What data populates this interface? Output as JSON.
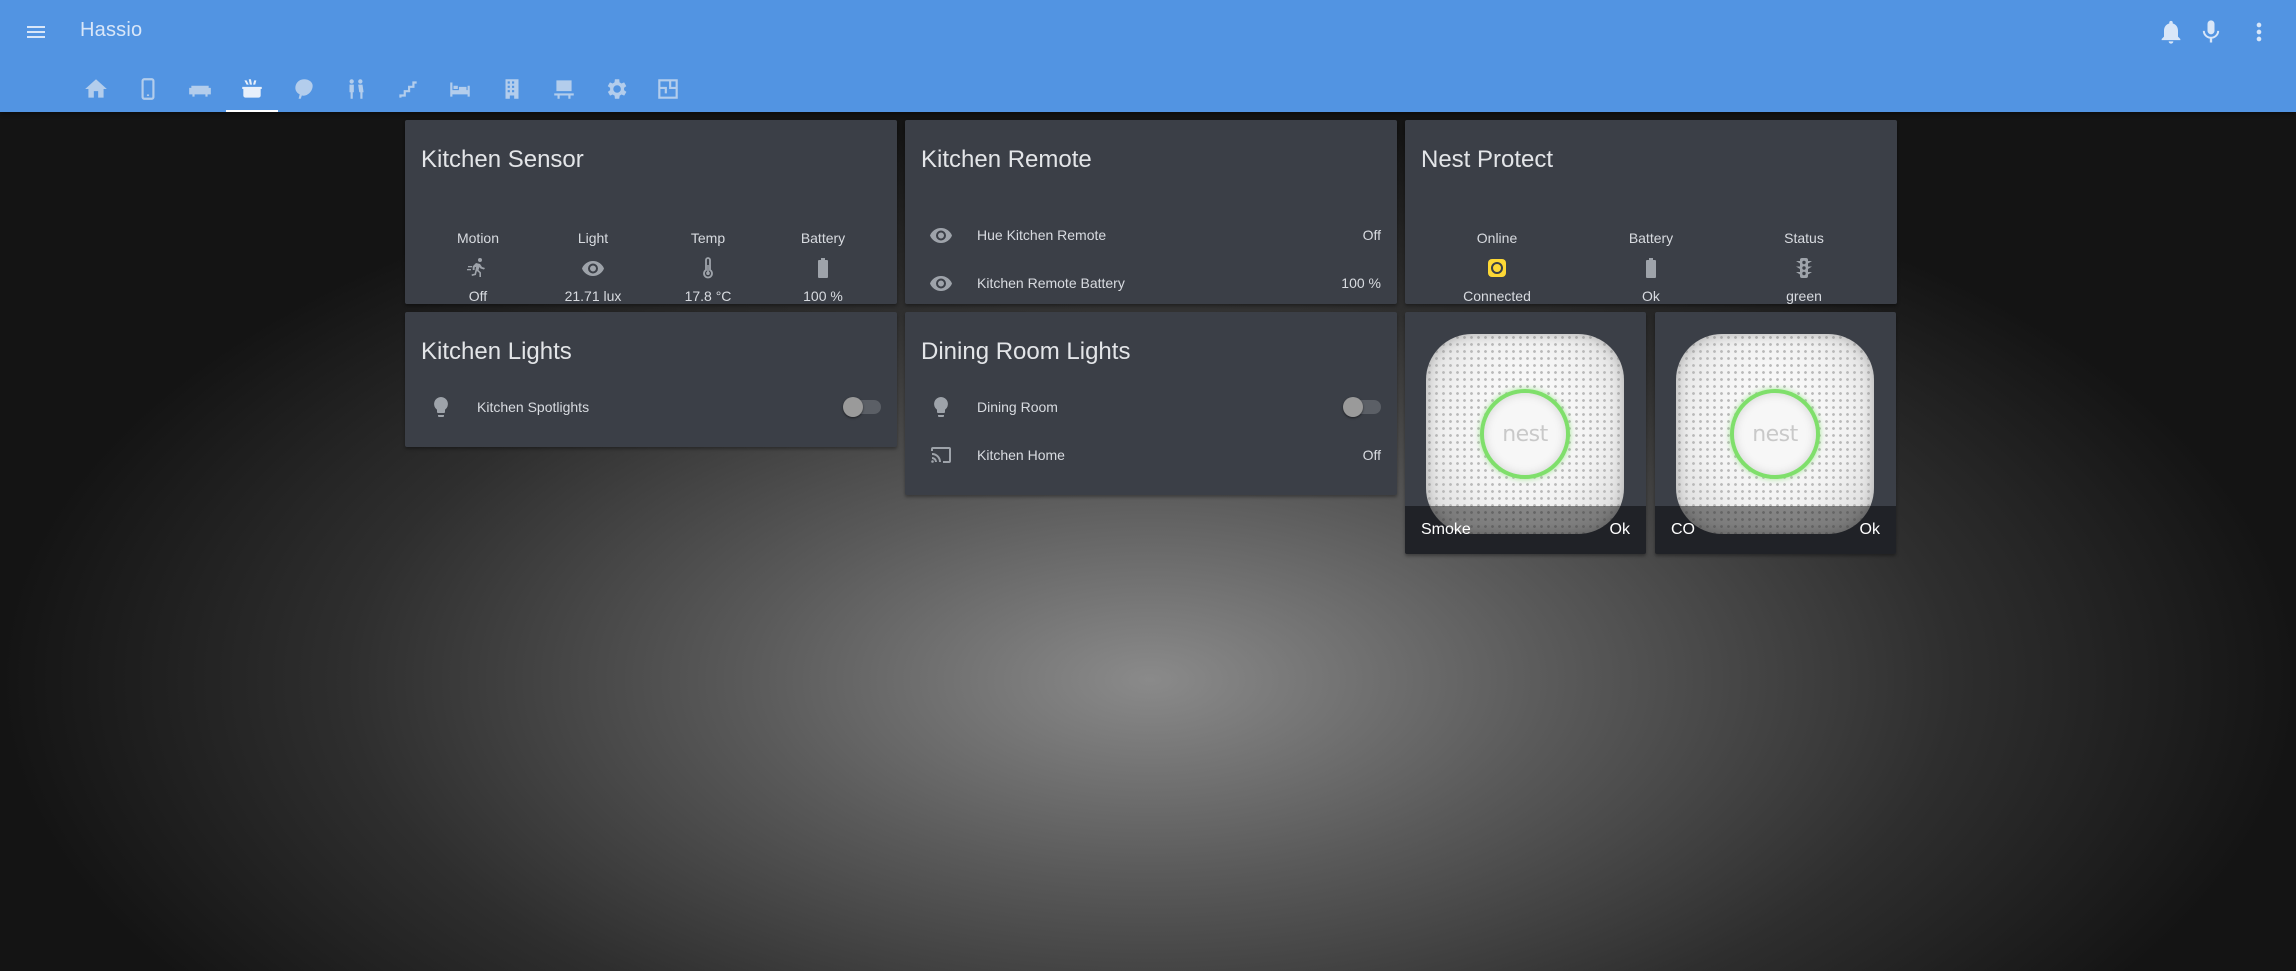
{
  "header": {
    "title": "Hassio",
    "icons": [
      "menu-icon",
      "bell-icon",
      "microphone-icon",
      "more-vert-icon"
    ]
  },
  "tabs": [
    {
      "icon": "home-icon",
      "active": false
    },
    {
      "icon": "phone-icon",
      "active": false
    },
    {
      "icon": "sofa-icon",
      "active": false
    },
    {
      "icon": "kitchen-pot-icon",
      "active": true
    },
    {
      "icon": "leaf-icon",
      "active": false
    },
    {
      "icon": "people-icon",
      "active": false
    },
    {
      "icon": "stairs-icon",
      "active": false
    },
    {
      "icon": "bed-icon",
      "active": false
    },
    {
      "icon": "building-icon",
      "active": false
    },
    {
      "icon": "desk-icon",
      "active": false
    },
    {
      "icon": "settings-icon",
      "active": false
    },
    {
      "icon": "floor-plan-icon",
      "active": false
    }
  ],
  "cards": {
    "kitchen_sensor": {
      "title": "Kitchen Sensor",
      "glances": [
        {
          "name": "Motion",
          "icon": "motion-run-icon",
          "state": "Off"
        },
        {
          "name": "Light",
          "icon": "eye-icon",
          "state": "21.71 lux"
        },
        {
          "name": "Temp",
          "icon": "thermometer-icon",
          "state": "17.8 °C"
        },
        {
          "name": "Battery",
          "icon": "battery-icon",
          "state": "100 %"
        }
      ]
    },
    "kitchen_remote": {
      "title": "Kitchen Remote",
      "entities": [
        {
          "icon": "eye-icon",
          "name": "Hue Kitchen Remote",
          "state": "Off"
        },
        {
          "icon": "eye-icon",
          "name": "Kitchen Remote Battery",
          "state": "100 %"
        }
      ]
    },
    "nest_protect": {
      "title": "Nest Protect",
      "glances": [
        {
          "name": "Online",
          "icon": "nest-online-icon",
          "state": "Connected",
          "color": "#fdd835"
        },
        {
          "name": "Battery",
          "icon": "battery-icon",
          "state": "Ok"
        },
        {
          "name": "Status",
          "icon": "traffic-light-icon",
          "state": "green"
        }
      ]
    },
    "kitchen_lights": {
      "title": "Kitchen Lights",
      "entities": [
        {
          "icon": "lightbulb-icon",
          "name": "Kitchen Spotlights",
          "toggle": false
        }
      ]
    },
    "dining_room_lights": {
      "title": "Dining Room Lights",
      "entities": [
        {
          "icon": "lightbulb-icon",
          "name": "Dining Room",
          "toggle": false
        },
        {
          "icon": "cast-icon",
          "name": "Kitchen Home",
          "state": "Off"
        }
      ]
    },
    "smoke": {
      "label": "Smoke",
      "state": "Ok",
      "ring_color": "#7fdf6b"
    },
    "co": {
      "label": "CO",
      "state": "Ok",
      "ring_color": "#7fdf6b"
    },
    "nest_logo_text": "nest"
  },
  "colors": {
    "header": "#5294e2",
    "card": "#3b3f47",
    "icon": "#9ea3aa",
    "online": "#fdd835"
  }
}
